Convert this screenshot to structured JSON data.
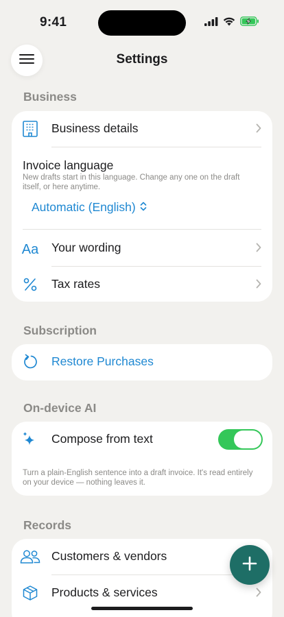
{
  "status_bar": {
    "time": "9:41"
  },
  "nav": {
    "title": "Settings"
  },
  "sections": {
    "business": {
      "header": "Business",
      "business_details": "Business details",
      "invoice_language": {
        "title": "Invoice language",
        "description": "New drafts start in this language. Change any one on the draft itself, or here anytime.",
        "value": "Automatic (English)"
      },
      "wording_icon_text": "Aa",
      "your_wording": "Your wording",
      "tax_rates": "Tax rates"
    },
    "subscription": {
      "header": "Subscription",
      "restore": "Restore Purchases"
    },
    "ai": {
      "header": "On-device AI",
      "compose": "Compose from text",
      "compose_enabled": true,
      "description": "Turn a plain-English sentence into a draft invoice. It's read entirely on your device — nothing leaves it."
    },
    "records": {
      "header": "Records",
      "customers": "Customers & vendors",
      "products": "Products & services"
    }
  },
  "colors": {
    "accent": "#1f88d2",
    "toggle_on": "#34c759",
    "fab": "#1e6e66",
    "background": "#f2f1ee"
  }
}
